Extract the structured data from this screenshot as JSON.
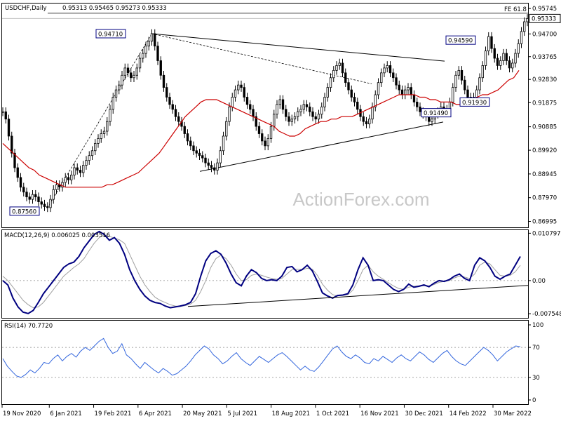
{
  "header": {
    "symbol": "USDCHF,Daily",
    "ohlc": "0.95313 0.95465 0.95273 0.95333",
    "fe_label": "FE 61.8"
  },
  "watermark": "ActionForex.com",
  "colors": {
    "candles": "#000000",
    "ma": "#cc0000",
    "macd": "#000080",
    "signal": "#a0a0a0",
    "rsi": "#3366dd",
    "trendline": "#000000",
    "price_box": "#000080"
  },
  "chart_data": [
    {
      "type": "candlestick",
      "title": "USDCHF,Daily",
      "ylim": [
        0.8675,
        0.9595
      ],
      "y_ticks": [
        "0.95745",
        "0.94700",
        "0.93765",
        "0.92830",
        "0.91875",
        "0.90885",
        "0.89920",
        "0.88945",
        "0.87970",
        "0.86995"
      ],
      "y_tick_values": [
        0.95745,
        0.947,
        0.93765,
        0.9283,
        0.91875,
        0.90885,
        0.8992,
        0.88945,
        0.8797,
        0.86995
      ],
      "current_price": "0.95333",
      "current_price_value": 0.95333,
      "fe_level": 0.9555,
      "x_ticks": [
        "19 Nov 2020",
        "6 Jan 2021",
        "19 Feb 2021",
        "6 Apr 2021",
        "20 May 2021",
        "5 Jul 2021",
        "18 Aug 2021",
        "1 Oct 2021",
        "16 Nov 2021",
        "30 Dec 2021",
        "14 Feb 2022",
        "30 Mar 2022"
      ],
      "annotations": [
        {
          "label": "0.94710",
          "value": 0.9471
        },
        {
          "label": "0.87560",
          "value": 0.8756
        },
        {
          "label": "0.94590",
          "value": 0.9459
        },
        {
          "label": "0.91490",
          "value": 0.9149
        },
        {
          "label": "0.91930",
          "value": 0.9193
        }
      ],
      "close_series": [
        0.915,
        0.912,
        0.905,
        0.898,
        0.892,
        0.888,
        0.884,
        0.882,
        0.88,
        0.879,
        0.881,
        0.88,
        0.878,
        0.877,
        0.876,
        0.8756,
        0.879,
        0.883,
        0.885,
        0.884,
        0.886,
        0.888,
        0.887,
        0.889,
        0.892,
        0.891,
        0.89,
        0.893,
        0.895,
        0.897,
        0.899,
        0.902,
        0.904,
        0.906,
        0.907,
        0.911,
        0.916,
        0.921,
        0.924,
        0.926,
        0.93,
        0.933,
        0.931,
        0.929,
        0.93,
        0.933,
        0.937,
        0.939,
        0.942,
        0.944,
        0.9471,
        0.942,
        0.936,
        0.93,
        0.925,
        0.921,
        0.918,
        0.916,
        0.913,
        0.911,
        0.909,
        0.906,
        0.903,
        0.901,
        0.899,
        0.898,
        0.897,
        0.896,
        0.894,
        0.893,
        0.892,
        0.891,
        0.894,
        0.899,
        0.905,
        0.911,
        0.917,
        0.921,
        0.924,
        0.926,
        0.925,
        0.921,
        0.918,
        0.916,
        0.913,
        0.909,
        0.906,
        0.903,
        0.901,
        0.904,
        0.909,
        0.914,
        0.918,
        0.92,
        0.916,
        0.913,
        0.911,
        0.912,
        0.913,
        0.915,
        0.916,
        0.918,
        0.917,
        0.915,
        0.913,
        0.912,
        0.914,
        0.917,
        0.921,
        0.925,
        0.929,
        0.932,
        0.934,
        0.935,
        0.931,
        0.927,
        0.924,
        0.921,
        0.919,
        0.916,
        0.913,
        0.911,
        0.91,
        0.912,
        0.917,
        0.922,
        0.927,
        0.931,
        0.933,
        0.934,
        0.931,
        0.929,
        0.926,
        0.924,
        0.922,
        0.924,
        0.925,
        0.922,
        0.919,
        0.917,
        0.915,
        0.914,
        0.913,
        0.911,
        0.912,
        0.914,
        0.915,
        0.917,
        0.9149,
        0.916,
        0.919,
        0.925,
        0.93,
        0.932,
        0.928,
        0.924,
        0.921,
        0.9193,
        0.921,
        0.924,
        0.929,
        0.934,
        0.94,
        0.9459,
        0.941,
        0.937,
        0.934,
        0.936,
        0.939,
        0.936,
        0.933,
        0.935,
        0.939,
        0.943,
        0.948,
        0.952,
        0.95333
      ],
      "ma_series": [
        0.902,
        0.9,
        0.898,
        0.896,
        0.894,
        0.892,
        0.891,
        0.889,
        0.888,
        0.887,
        0.886,
        0.885,
        0.884,
        0.884,
        0.884,
        0.884,
        0.884,
        0.884,
        0.884,
        0.884,
        0.885,
        0.885,
        0.886,
        0.887,
        0.888,
        0.889,
        0.89,
        0.892,
        0.894,
        0.896,
        0.898,
        0.901,
        0.904,
        0.907,
        0.91,
        0.913,
        0.915,
        0.917,
        0.919,
        0.92,
        0.92,
        0.92,
        0.919,
        0.918,
        0.917,
        0.916,
        0.915,
        0.914,
        0.913,
        0.912,
        0.911,
        0.91,
        0.909,
        0.907,
        0.906,
        0.905,
        0.905,
        0.906,
        0.908,
        0.909,
        0.91,
        0.911,
        0.911,
        0.912,
        0.912,
        0.913,
        0.913,
        0.913,
        0.914,
        0.915,
        0.916,
        0.917,
        0.918,
        0.919,
        0.92,
        0.921,
        0.922,
        0.922,
        0.922,
        0.922,
        0.921,
        0.921,
        0.92,
        0.92,
        0.919,
        0.919,
        0.919,
        0.918,
        0.918,
        0.919,
        0.92,
        0.921,
        0.922,
        0.922,
        0.923,
        0.924,
        0.926,
        0.928,
        0.929,
        0.932
      ]
    },
    {
      "type": "line",
      "title": "MACD(12,26,9) 0.006025 0.003516",
      "ylim": [
        -0.0085,
        0.0115
      ],
      "y_ticks": [
        "0.010797",
        "0.00",
        "-0.007548"
      ],
      "y_tick_values": [
        0.010797,
        0.0,
        -0.007548
      ],
      "series": [
        {
          "name": "MACD",
          "values": [
            0.0,
            -0.001,
            -0.004,
            -0.006,
            -0.0072,
            -0.0075,
            -0.0068,
            -0.005,
            -0.003,
            -0.0015,
            -0.0,
            0.0015,
            0.003,
            0.0038,
            0.0042,
            0.0055,
            0.0075,
            0.009,
            0.0105,
            0.0112,
            0.0105,
            0.0092,
            0.0098,
            0.0085,
            0.006,
            0.0025,
            0.0,
            -0.002,
            -0.0035,
            -0.0045,
            -0.005,
            -0.0052,
            -0.0058,
            -0.0062,
            -0.006,
            -0.0058,
            -0.0055,
            -0.005,
            -0.003,
            0.001,
            0.0045,
            0.0062,
            0.0068,
            0.006,
            0.004,
            0.0015,
            -0.0005,
            -0.0012,
            0.001,
            0.0025,
            0.0018,
            0.0005,
            0.0,
            0.0002,
            0.0,
            0.001,
            0.003,
            0.0032,
            0.002,
            0.0025,
            0.0035,
            0.0022,
            -0.0002,
            -0.0028,
            -0.0035,
            -0.004,
            -0.0034,
            -0.0033,
            -0.003,
            -0.001,
            0.0025,
            0.0052,
            0.0035,
            0.0,
            0.0002,
            -0.0,
            -0.001,
            -0.002,
            -0.0025,
            -0.002,
            -0.0008,
            -0.0015,
            -0.0013,
            -0.001,
            -0.0014,
            -0.0006,
            0.0,
            -0.0002,
            0.0002,
            0.001,
            0.0015,
            0.0005,
            0.0,
            0.0035,
            0.0052,
            0.0045,
            0.003,
            0.001,
            0.0003,
            0.001,
            0.0015,
            0.0035,
            0.0055
          ]
        },
        {
          "name": "Signal",
          "values": [
            0.001,
            0.0,
            -0.0015,
            -0.003,
            -0.0045,
            -0.0055,
            -0.0062,
            -0.006,
            -0.005,
            -0.0035,
            -0.002,
            -0.0005,
            0.001,
            0.002,
            0.003,
            0.0038,
            0.005,
            0.0068,
            0.0085,
            0.0098,
            0.0104,
            0.0101,
            0.0097,
            0.0093,
            0.0085,
            0.006,
            0.0035,
            0.001,
            -0.001,
            -0.0025,
            -0.0038,
            -0.0045,
            -0.005,
            -0.0055,
            -0.0058,
            -0.0059,
            -0.0057,
            -0.0054,
            -0.0045,
            -0.0025,
            0.0,
            0.003,
            0.005,
            0.0058,
            0.005,
            0.0035,
            0.0015,
            0.0,
            0.0002,
            0.0012,
            0.0015,
            0.0012,
            0.0008,
            0.0005,
            0.0003,
            0.0005,
            0.0015,
            0.0025,
            0.0026,
            0.0025,
            0.0028,
            0.0026,
            0.0012,
            -0.0008,
            -0.0022,
            -0.0032,
            -0.0035,
            -0.0034,
            -0.0032,
            -0.0022,
            0.0,
            0.0025,
            0.0035,
            0.002,
            0.001,
            0.0003,
            -0.0005,
            -0.0012,
            -0.0018,
            -0.002,
            -0.0015,
            -0.0013,
            -0.0012,
            -0.0012,
            -0.0012,
            -0.0009,
            -0.0004,
            -0.0002,
            0.0,
            0.0006,
            0.001,
            0.0008,
            0.0005,
            0.0015,
            0.0035,
            0.0042,
            0.0038,
            0.0025,
            0.0012,
            0.001,
            0.0012,
            0.002,
            0.0035
          ]
        }
      ]
    },
    {
      "type": "line",
      "title": "RSI(14) 70.7720",
      "ylim": [
        0,
        100
      ],
      "y_ticks": [
        "100",
        "70",
        "30",
        "0"
      ],
      "y_tick_values": [
        100,
        70,
        30,
        0
      ],
      "series": [
        {
          "name": "RSI",
          "values": [
            55,
            45,
            38,
            32,
            30,
            34,
            40,
            36,
            42,
            50,
            48,
            55,
            60,
            52,
            58,
            62,
            57,
            65,
            70,
            66,
            72,
            78,
            82,
            70,
            62,
            65,
            75,
            60,
            55,
            48,
            42,
            50,
            45,
            40,
            36,
            42,
            38,
            33,
            35,
            40,
            45,
            52,
            60,
            66,
            72,
            68,
            60,
            55,
            48,
            52,
            58,
            63,
            55,
            50,
            46,
            52,
            58,
            54,
            50,
            55,
            60,
            63,
            58,
            52,
            46,
            40,
            45,
            40,
            38,
            44,
            52,
            60,
            68,
            72,
            64,
            58,
            55,
            60,
            56,
            50,
            48,
            55,
            52,
            58,
            54,
            50,
            56,
            60,
            55,
            52,
            58,
            64,
            60,
            54,
            50,
            56,
            62,
            66,
            58,
            52,
            48,
            46,
            52,
            58,
            64,
            70,
            66,
            60,
            52,
            58,
            64,
            68,
            72,
            70.772
          ]
        }
      ]
    }
  ]
}
